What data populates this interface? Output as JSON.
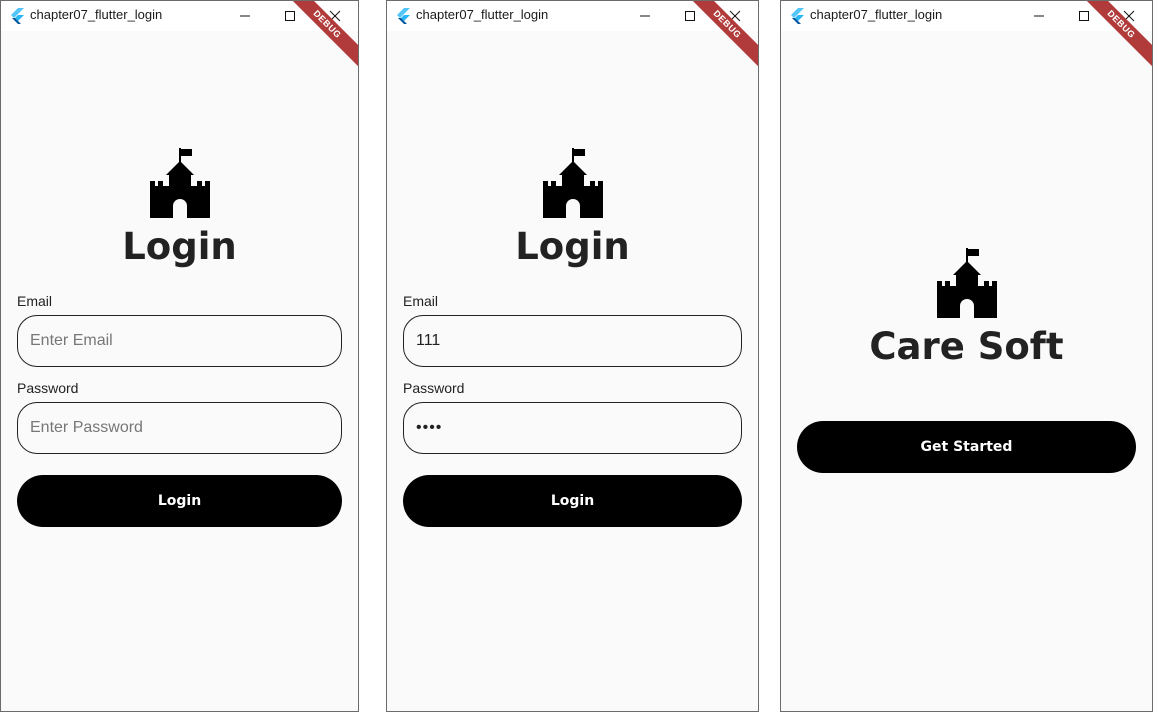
{
  "windows": [
    {
      "title": "chapter07_flutter_login",
      "debug_banner": "DEBUG",
      "heading": "Login",
      "email_label": "Email",
      "email_placeholder": "Enter Email",
      "password_label": "Password",
      "password_placeholder": "Enter Password",
      "button_label": "Login"
    },
    {
      "title": "chapter07_flutter_login",
      "debug_banner": "DEBUG",
      "heading": "Login",
      "email_label": "Email",
      "email_value": "111",
      "password_label": "Password",
      "password_value": "••••",
      "button_label": "Login"
    },
    {
      "title": "chapter07_flutter_login",
      "debug_banner": "DEBUG",
      "heading": "Care Soft",
      "button_label": "Get Started"
    }
  ],
  "icons": {
    "app": "flutter-logo-icon",
    "minimize": "minimize-icon",
    "maximize": "maximize-icon",
    "close": "close-icon",
    "hero": "castle-icon"
  },
  "colors": {
    "background": "#fafafa",
    "button": "#000000",
    "debug_banner": "#b13b3b",
    "flutter_logo": "#3fa9f5"
  }
}
